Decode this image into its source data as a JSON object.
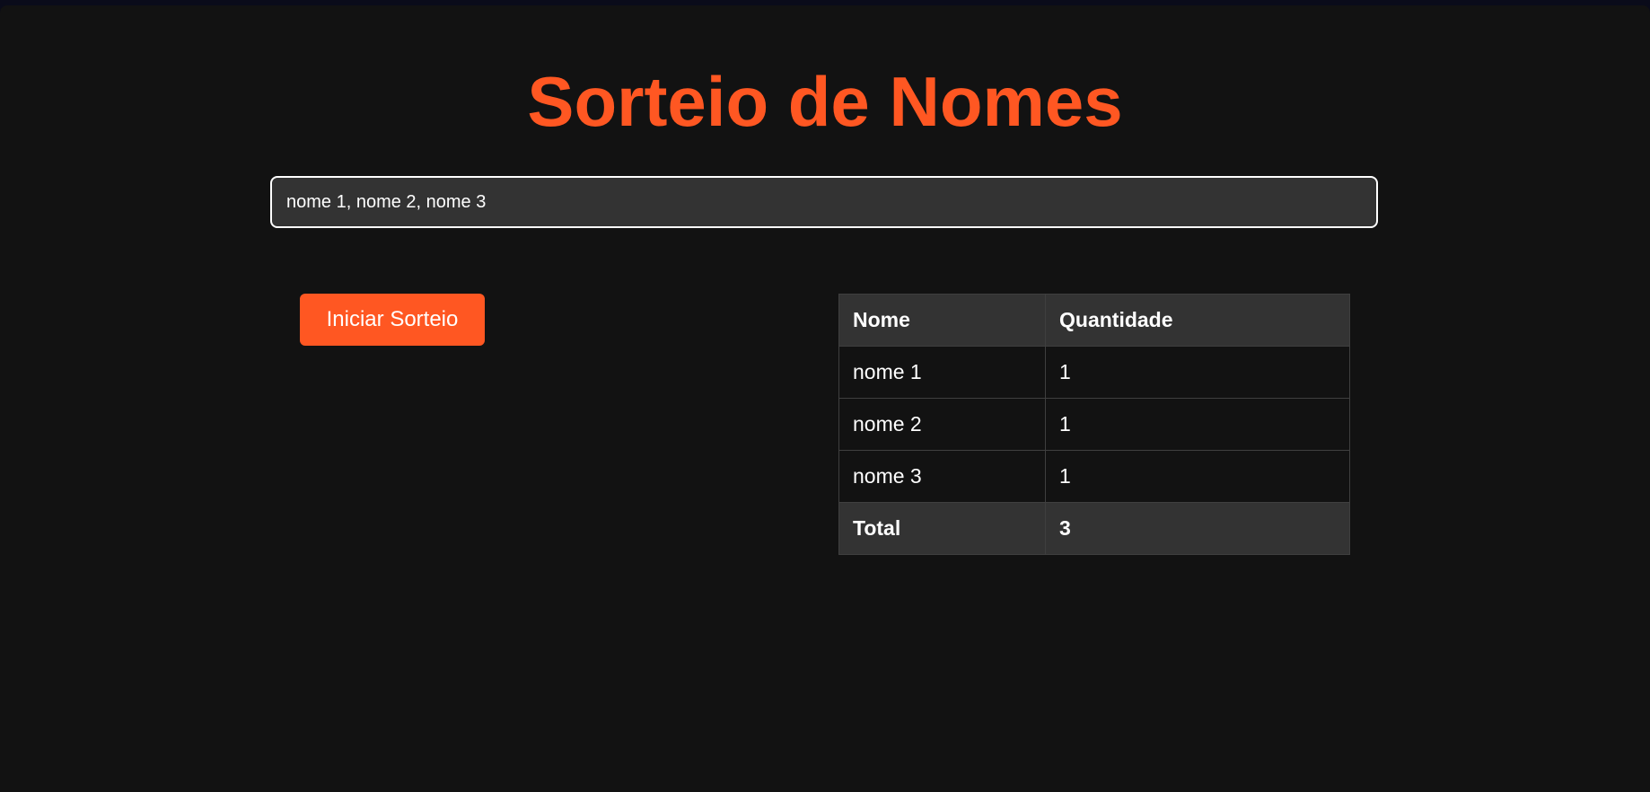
{
  "page": {
    "title": "Sorteio de Nomes"
  },
  "names_input": {
    "value": "nome 1, nome 2, nome 3",
    "placeholder": ""
  },
  "start_button": {
    "label": "Iniciar Sorteio"
  },
  "table": {
    "headers": [
      "Nome",
      "Quantidade"
    ],
    "rows": [
      {
        "name": "nome 1",
        "count": "1"
      },
      {
        "name": "nome 2",
        "count": "1"
      },
      {
        "name": "nome 3",
        "count": "1"
      }
    ],
    "total": {
      "label": "Total",
      "value": "3"
    }
  },
  "colors": {
    "accent": "#ff5722",
    "background": "#121212",
    "surface": "#333333",
    "text": "#ffffff"
  }
}
